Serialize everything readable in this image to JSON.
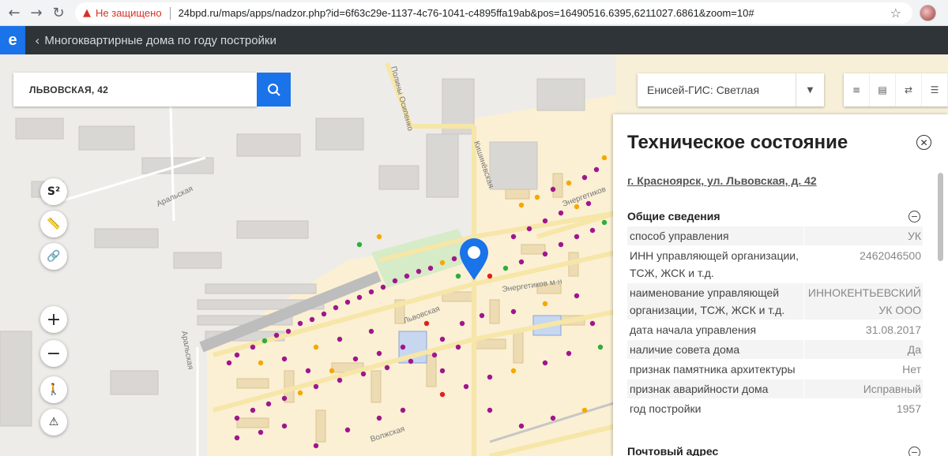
{
  "browser": {
    "security_label": "Не защищено",
    "url": "24bpd.ru/maps/apps/nadzor.php?id=6f63c29e-1137-4c76-1041-c4895ffa19ab&pos=16490516.6395,6211027.6861&zoom=10#"
  },
  "app": {
    "logo": "e",
    "title": "Многоквартирные дома по году постройки"
  },
  "search": {
    "value": "ЛЬВОВСКАЯ, 42"
  },
  "basemap": {
    "selected": "Енисей-ГИС: Светлая"
  },
  "map_buttons": {
    "area": "S²"
  },
  "map": {
    "streets": [
      "Аральская",
      "Аральская",
      "Львовская",
      "Кишинёвская",
      "Энергетиков",
      "Энергетиков м-н",
      "Волжская",
      "Полины Осипенко"
    ],
    "colors": {
      "purple": "#a0168c",
      "red": "#e0201c",
      "orange": "#f5a800",
      "green": "#2cae3c",
      "marker": "#1a73e8"
    }
  },
  "panel": {
    "title": "Техническое состояние",
    "address": "г. Красноярск, ул. Львовская, д. 42",
    "section1": "Общие сведения",
    "rows": [
      {
        "k": "способ управления",
        "v": "УК"
      },
      {
        "k": "ИНН управляющей организации, ТСЖ, ЖСК и т.д.",
        "v": "2462046500"
      },
      {
        "k": "наименование управляющей организации, ТСЖ, ЖСК и т.д.",
        "v": "ИННОКЕНТЬЕВСКИЙ УК ООО"
      },
      {
        "k": "дата начала управления",
        "v": "31.08.2017"
      },
      {
        "k": "наличие совета дома",
        "v": "Да"
      },
      {
        "k": "признак памятника архитектуры",
        "v": "Нет"
      },
      {
        "k": "признак аварийности дома",
        "v": "Исправный"
      },
      {
        "k": "год постройки",
        "v": "1957"
      }
    ],
    "section2": "Почтовый адрес"
  }
}
